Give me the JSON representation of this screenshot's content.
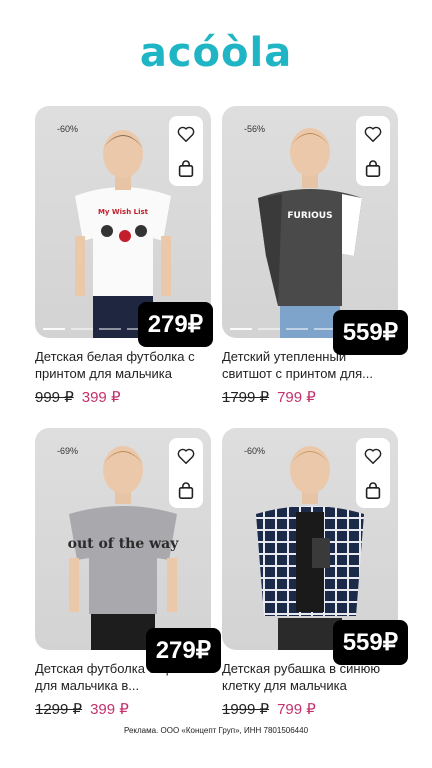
{
  "brand": {
    "logo_text": "acóòla",
    "logo_color": "#1fb5c4"
  },
  "accent_colors": {
    "sale_price": "#c4316b",
    "badge_bg": "#000000"
  },
  "products": [
    {
      "discount": "-60%",
      "badge_price": "279₽",
      "title": "Детская белая футболка с принтом для мальчика",
      "old_price": "999 ₽",
      "new_price": "399 ₽",
      "shirt_text": "My Wish List",
      "icons": [
        "heart-icon",
        "bag-icon"
      ]
    },
    {
      "discount": "-56%",
      "badge_price": "559₽",
      "title": "Детский утепленный свитшот с принтом для...",
      "old_price": "1799 ₽",
      "new_price": "799 ₽",
      "shirt_text": "FURIOUS",
      "icons": [
        "heart-icon",
        "bag-icon"
      ]
    },
    {
      "discount": "-69%",
      "badge_price": "279₽",
      "title": "Детская футболка с принтом для мальчика в...",
      "old_price": "1299 ₽",
      "new_price": "399 ₽",
      "shirt_text": "out of the way",
      "icons": [
        "heart-icon",
        "bag-icon"
      ]
    },
    {
      "discount": "-60%",
      "badge_price": "559₽",
      "title": "Детская рубашка в синюю клетку для мальчика",
      "old_price": "1999 ₽",
      "new_price": "799 ₽",
      "shirt_text": "",
      "icons": [
        "heart-icon",
        "bag-icon"
      ]
    }
  ],
  "footer": {
    "disclaimer": "Реклама. ООО «Концепт Груп», ИНН 7801506440"
  }
}
